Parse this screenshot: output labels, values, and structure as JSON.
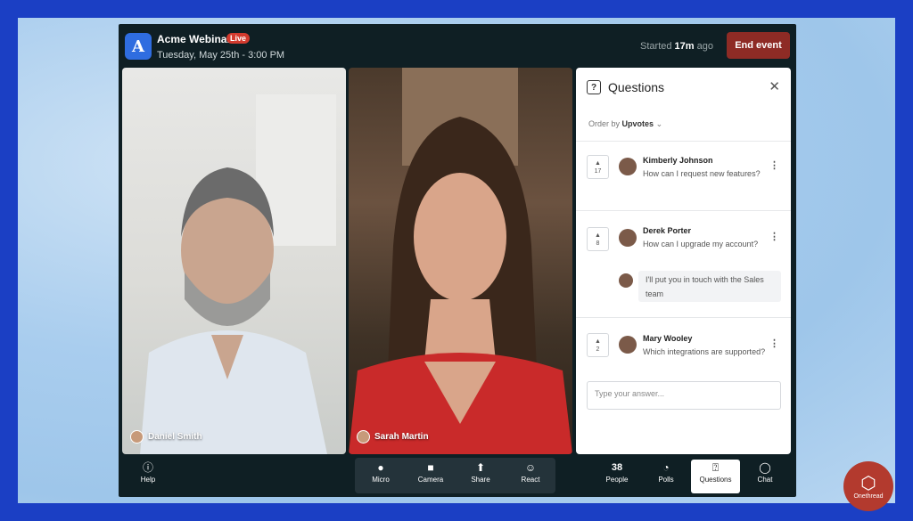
{
  "header": {
    "logo_letter": "A",
    "title": "Acme Webinar",
    "live_badge": "Live",
    "date": "Tuesday, May 25th - 3:00 PM",
    "started_prefix": "Started",
    "started_value": "17m",
    "started_suffix": "ago",
    "end_label": "End event"
  },
  "participants": [
    {
      "name": "Daniel Smith"
    },
    {
      "name": "Sarah Martin"
    }
  ],
  "questions_panel": {
    "title": "Questions",
    "order_by_label": "Order by",
    "order_by_value": "Upvotes",
    "items": [
      {
        "votes": "17",
        "author": "Kimberly Johnson",
        "text": "How can I request new features?"
      },
      {
        "votes": "8",
        "author": "Derek Porter",
        "text": "How can I upgrade my account?",
        "reply": "I'll put you in touch with the Sales team"
      },
      {
        "votes": "2",
        "author": "Mary Wooley",
        "text": "Which integrations are supported?"
      }
    ],
    "answer_placeholder": "Type your answer..."
  },
  "bottom_bar": {
    "help": "Help",
    "micro": "Micro",
    "camera": "Camera",
    "share": "Share",
    "react": "React",
    "people_count": "38",
    "people": "People",
    "polls": "Polls",
    "questions": "Questions",
    "chat": "Chat"
  },
  "branding": {
    "onethread": "Onethread"
  },
  "colors": {
    "accent": "#2f6de0",
    "end_button": "#8e2b25",
    "live": "#d23a2e",
    "app_bg": "#0f1f24"
  }
}
